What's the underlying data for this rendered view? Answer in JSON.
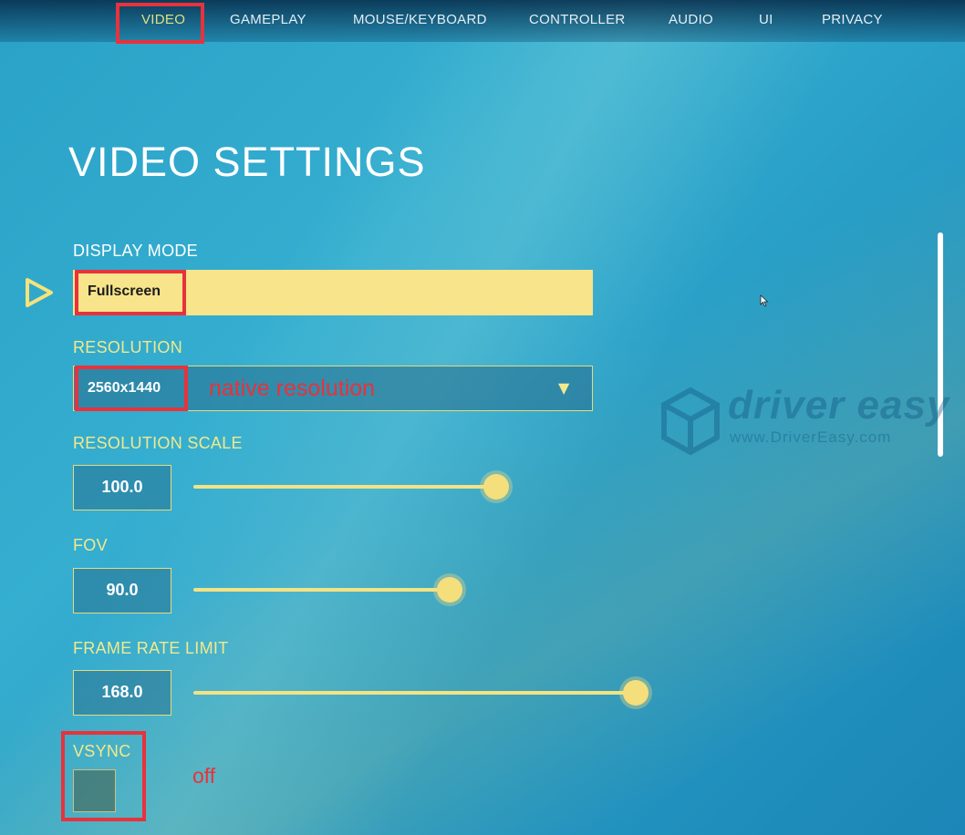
{
  "nav": {
    "tabs": [
      {
        "label": "VIDEO",
        "active": true
      },
      {
        "label": "GAMEPLAY",
        "active": false
      },
      {
        "label": "MOUSE/KEYBOARD",
        "active": false
      },
      {
        "label": "CONTROLLER",
        "active": false
      },
      {
        "label": "AUDIO",
        "active": false
      },
      {
        "label": "UI",
        "active": false
      },
      {
        "label": "PRIVACY",
        "active": false
      }
    ]
  },
  "page": {
    "title": "VIDEO SETTINGS"
  },
  "settings": {
    "display_mode": {
      "label": "DISPLAY MODE",
      "value": "Fullscreen"
    },
    "resolution": {
      "label": "RESOLUTION",
      "value": "2560x1440",
      "annotation": "native resolution"
    },
    "resolution_scale": {
      "label": "RESOLUTION SCALE",
      "value": "100.0",
      "level": 0.65
    },
    "fov": {
      "label": "FOV",
      "value": "90.0",
      "level": 0.55
    },
    "frame_rate_limit": {
      "label": "FRAME RATE LIMIT",
      "value": "168.0",
      "level": 0.95
    },
    "vsync": {
      "label": "VSYNC",
      "checked": false,
      "annotation": "off"
    }
  },
  "watermark": {
    "brand": "driver easy",
    "url": "www.DriverEasy.com"
  },
  "colors": {
    "accent_yellow": "#f1e98d",
    "highlight_red": "#e8323c",
    "field_yellow": "#f8e48a",
    "background_blue": "#2aa2c8"
  },
  "icons": {
    "selector": "play-triangle-outline",
    "dropdown": "triangle-down",
    "cursor": "mouse-pointer",
    "logo": "hexagon-cube"
  }
}
